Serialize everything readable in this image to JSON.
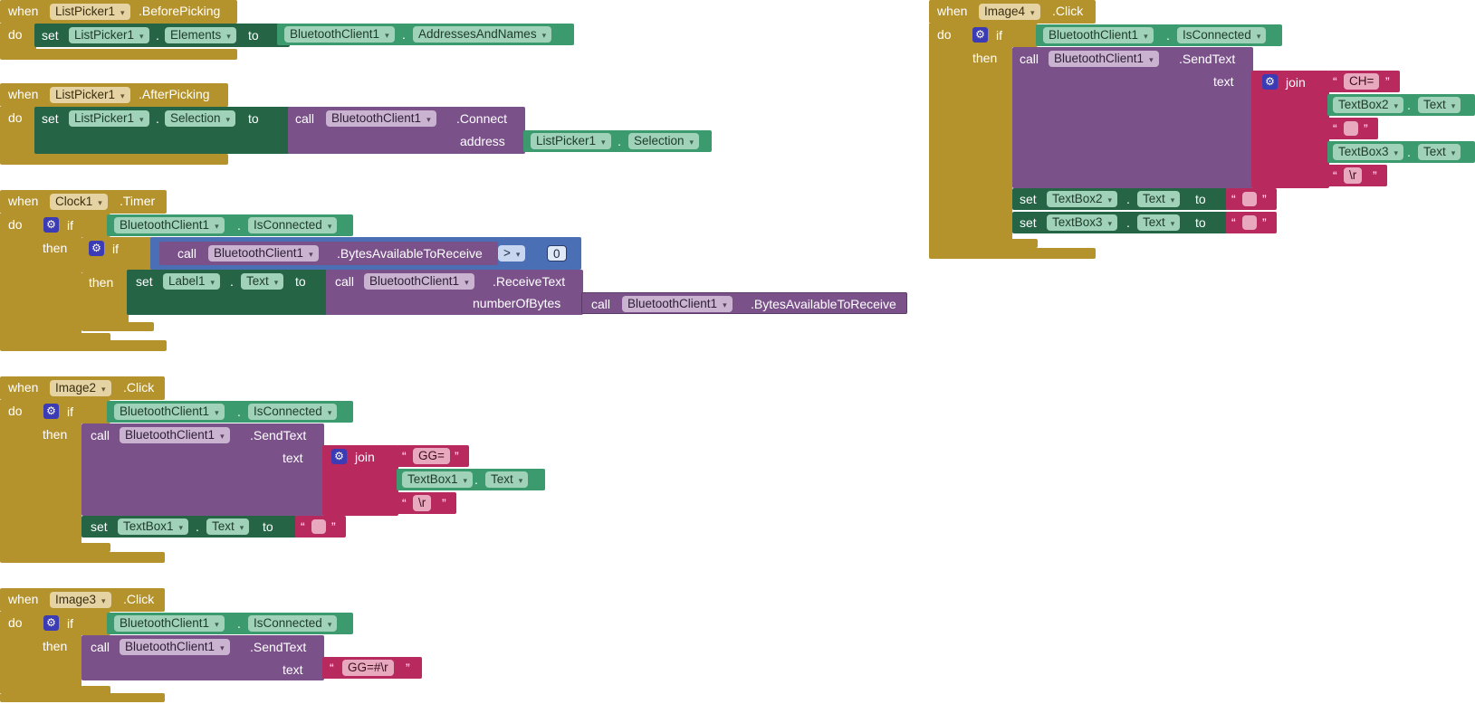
{
  "kw": {
    "when": "when",
    "do": "do",
    "if": "if",
    "then": "then",
    "set": "set",
    "to": "to",
    "call": "call",
    "dot": ".",
    "open_quote": "“",
    "close_quote": "”",
    "arrow": "▾"
  },
  "b1": {
    "component": "ListPicker1",
    "event": ".BeforePicking",
    "set_comp": "ListPicker1",
    "set_prop": "Elements",
    "src_comp": "BluetoothClient1",
    "src_prop": "AddressesAndNames"
  },
  "b2": {
    "component": "ListPicker1",
    "event": ".AfterPicking",
    "set_comp": "ListPicker1",
    "set_prop": "Selection",
    "call_comp": "BluetoothClient1",
    "method": ".Connect",
    "arg_label": "address",
    "arg_comp": "ListPicker1",
    "arg_prop": "Selection"
  },
  "b3": {
    "component": "Clock1",
    "event": ".Timer",
    "if_comp": "BluetoothClient1",
    "if_prop": "IsConnected",
    "call_comp": "BluetoothClient1",
    "call_method": ".BytesAvailableToReceive",
    "op": ">",
    "num": "0",
    "set_comp": "Label1",
    "set_prop": "Text",
    "recv_comp": "BluetoothClient1",
    "recv_method": ".ReceiveText",
    "arg_label": "numberOfBytes",
    "arg_comp": "BluetoothClient1",
    "arg_method": ".BytesAvailableToReceive"
  },
  "b4": {
    "component": "Image2",
    "event": ".Click",
    "if_comp": "BluetoothClient1",
    "if_prop": "IsConnected",
    "call_comp": "BluetoothClient1",
    "method": ".SendText",
    "arg_label": "text",
    "join": "join",
    "s1": "GG=",
    "tb_comp": "TextBox1",
    "tb_prop": "Text",
    "s2": "\\r",
    "set_comp": "TextBox1",
    "set_prop": "Text"
  },
  "b5": {
    "component": "Image3",
    "event": ".Click",
    "if_comp": "BluetoothClient1",
    "if_prop": "IsConnected",
    "call_comp": "BluetoothClient1",
    "method": ".SendText",
    "arg_label": "text",
    "s1": "GG=#\\r"
  },
  "b6": {
    "component": "Image4",
    "event": ".Click",
    "if_comp": "BluetoothClient1",
    "if_prop": "IsConnected",
    "call_comp": "BluetoothClient1",
    "method": ".SendText",
    "arg_label": "text",
    "join": "join",
    "s1": "CH=",
    "tb2_comp": "TextBox2",
    "tb2_prop": "Text",
    "tb3_comp": "TextBox3",
    "tb3_prop": "Text",
    "s3": "\\r",
    "set1_comp": "TextBox2",
    "set1_prop": "Text",
    "set2_comp": "TextBox3",
    "set2_prop": "Text"
  }
}
